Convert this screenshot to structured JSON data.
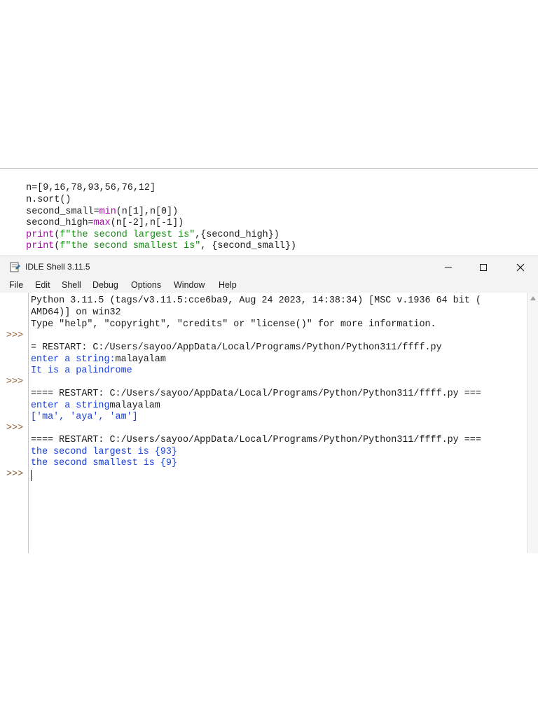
{
  "editor": {
    "lines": [
      {
        "a": "n=[9,16,78,93,56,76,12]"
      },
      {
        "a": "n.sort()"
      },
      {
        "a": "second_small=",
        "b": "min",
        "c": "(n[1],n[0])"
      },
      {
        "a": "second_high=",
        "b": "max",
        "c": "(n[-2],n[-1])"
      },
      {
        "b": "print",
        "a": "(",
        "s": "f\"the second largest is\"",
        "c": ",{second_high})"
      },
      {
        "b": "print",
        "a": "(",
        "s": "f\"the second smallest is\"",
        "c": ", {second_small})"
      }
    ]
  },
  "window": {
    "title": "IDLE Shell 3.11.5",
    "app_icon": "idle-python-icon",
    "controls": {
      "minimize": "—",
      "maximize": "☐",
      "close": "✕"
    }
  },
  "menu": [
    "File",
    "Edit",
    "Shell",
    "Debug",
    "Options",
    "Window",
    "Help"
  ],
  "shell": {
    "prompt": ">>>",
    "lines": [
      {
        "text": "Python 3.11.5 (tags/v3.11.5:cce6ba9, Aug 24 2023, 14:38:34) [MSC v.1936 64 bit (",
        "kind": "out"
      },
      {
        "text": "AMD64)] on win32",
        "kind": "out"
      },
      {
        "text": "Type \"help\", \"copyright\", \"credits\" or \"license()\" for more information.",
        "kind": "out"
      },
      {
        "text": "",
        "kind": "out"
      },
      {
        "text": "= RESTART: C:/Users/sayoo/AppData/Local/Programs/Python/Python311/ffff.py",
        "kind": "out"
      },
      {
        "text": "enter a string:",
        "kind": "blue",
        "input": "malayalam"
      },
      {
        "text": "It is a palindrome",
        "kind": "blue"
      },
      {
        "text": "",
        "kind": "out"
      },
      {
        "text": "==== RESTART: C:/Users/sayoo/AppData/Local/Programs/Python/Python311/ffff.py ===",
        "kind": "out"
      },
      {
        "text": "enter a string",
        "kind": "blue",
        "input": "malayalam"
      },
      {
        "text": "['ma', 'aya', 'am']",
        "kind": "blue"
      },
      {
        "text": "",
        "kind": "out"
      },
      {
        "text": "==== RESTART: C:/Users/sayoo/AppData/Local/Programs/Python/Python311/ffff.py ===",
        "kind": "out"
      },
      {
        "text": "the second largest is {93}",
        "kind": "blue"
      },
      {
        "text": "the second smallest is {9}",
        "kind": "blue"
      }
    ]
  },
  "colors": {
    "builtin": "#b000b0",
    "string": "#109010",
    "output": "#1a3fd6",
    "prompt": "#8b5a2b"
  }
}
